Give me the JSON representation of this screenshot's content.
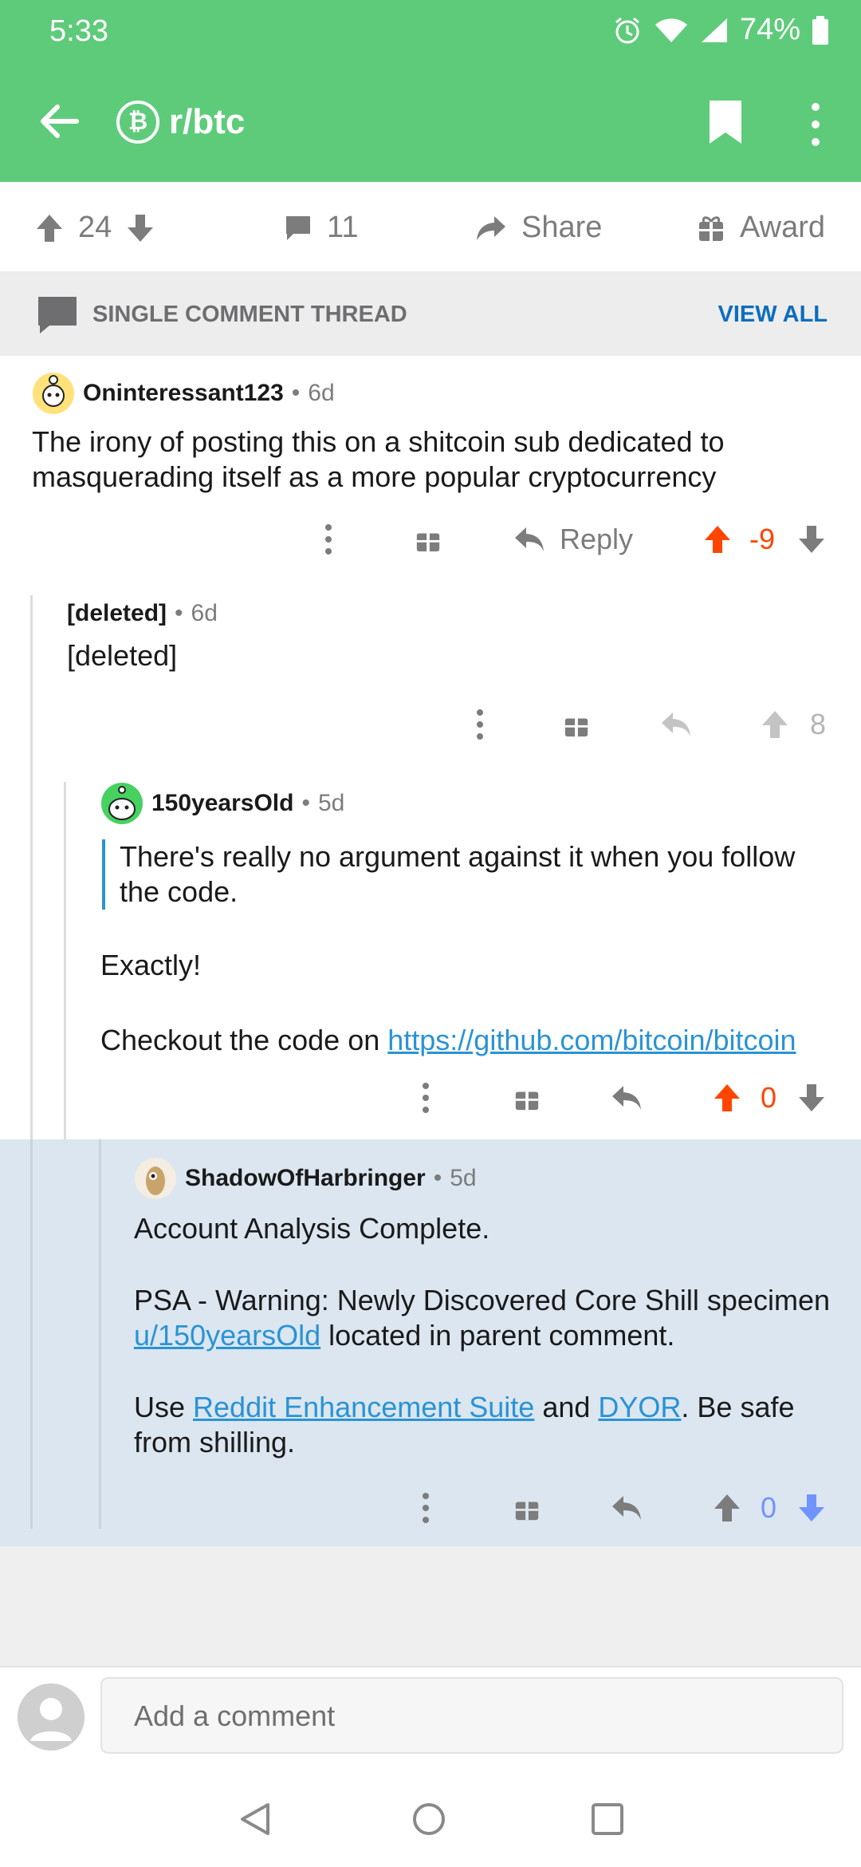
{
  "status_bar": {
    "time": "5:33",
    "battery": "74%"
  },
  "app_bar": {
    "subreddit": "r/btc",
    "sub_icon_glyph": "₿",
    "accent": "#5ecb7a"
  },
  "post_actions": {
    "score": "24",
    "comments": "11",
    "share_label": "Share",
    "award_label": "Award"
  },
  "thread_header": {
    "label": "SINGLE COMMENT THREAD",
    "view_all": "VIEW ALL"
  },
  "comments": [
    {
      "author": "Oninteressant123",
      "age": "6d",
      "body": "The irony of posting this on a shitcoin sub dedicated to masquerading itself as a more popular cryptocurrency",
      "reply_label": "Reply",
      "score": "-9"
    },
    {
      "author": "[deleted]",
      "age": "6d",
      "body": "[deleted]",
      "score": "8"
    },
    {
      "author": "150yearsOld",
      "age": "5d",
      "quote": "There's really no argument against it when you follow the code.",
      "line1": "Exactly!",
      "line2_prefix": "Checkout the code on ",
      "line2_link": "https://github.com/bitcoin/bitcoin",
      "score": "0"
    },
    {
      "author": "ShadowOfHarbringer",
      "age": "5d",
      "line1": "Account Analysis Complete.",
      "line2_prefix": "PSA - Warning: Newly Discovered Core Shill specimen ",
      "line2_link": "u/150yearsOld",
      "line2_suffix": " located in parent comment.",
      "line3_prefix": "Use ",
      "line3_link1": "Reddit Enhancement Suite",
      "line3_mid": " and ",
      "line3_link2": "DYOR",
      "line3_suffix": ". Be safe from shilling.",
      "score": "0"
    }
  ],
  "composer": {
    "placeholder": "Add a comment"
  },
  "colors": {
    "upvote": "#ff4500",
    "downvote": "#7193ff",
    "link": "#2a93d5"
  }
}
